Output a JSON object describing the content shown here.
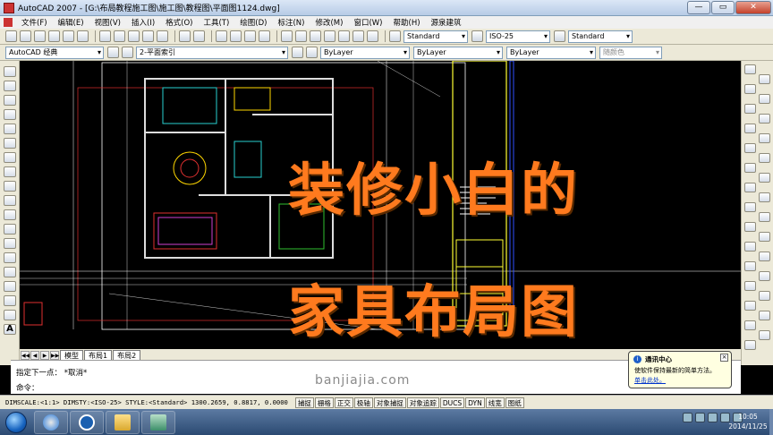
{
  "window": {
    "title": "AutoCAD 2007 - [G:\\布局教程施工图\\施工图\\教程图\\平面图1124.dwg]",
    "buttons": [
      "—",
      "▭",
      "✕"
    ]
  },
  "menu": {
    "items": [
      "文件(F)",
      "编辑(E)",
      "视图(V)",
      "插入(I)",
      "格式(O)",
      "工具(T)",
      "绘图(D)",
      "标注(N)",
      "修改(M)",
      "窗口(W)",
      "帮助(H)",
      "源泉建筑"
    ]
  },
  "toolbar1": {
    "text_style": "Standard",
    "dim_style": "ISO-25",
    "table_style": "Standard"
  },
  "toolbar2": {
    "workspace": "AutoCAD 经典",
    "layer": "2-平面索引",
    "color": "ByLayer",
    "linetype": "ByLayer",
    "lineweight": "ByLayer",
    "plotstyle": "随颜色"
  },
  "overlay": {
    "line1": "装修小白的",
    "line2": "家具布局图",
    "color": "#ff7a1e"
  },
  "tabs": {
    "nav": [
      "◀◀",
      "◀",
      "▶",
      "▶▶"
    ],
    "items": [
      "模型",
      "布局1",
      "布局2"
    ]
  },
  "command": {
    "line1": "指定下一点：  *取消*",
    "line2": "命令：",
    "watermark": "banjiajia.com"
  },
  "notification": {
    "title": "通讯中心",
    "body": "使软件保持最新的简单方法。",
    "link": "单击此处。",
    "close": "×"
  },
  "status": {
    "text": "DIMSCALE:<1:1> DIMSTY:<ISO-25> STYLE:<Standard>  1300.2659, 0.8817, 0.0000",
    "toggles": [
      "捕捉",
      "栅格",
      "正交",
      "极轴",
      "对象捕捉",
      "对象追踪",
      "DUCS",
      "DYN",
      "线宽",
      "图纸"
    ]
  },
  "taskbar": {
    "time": "10:05",
    "date": "2014/11/25",
    "apps": [
      "browser-icon",
      "k-player-icon",
      "folder-icon",
      "autocad-icon"
    ]
  }
}
